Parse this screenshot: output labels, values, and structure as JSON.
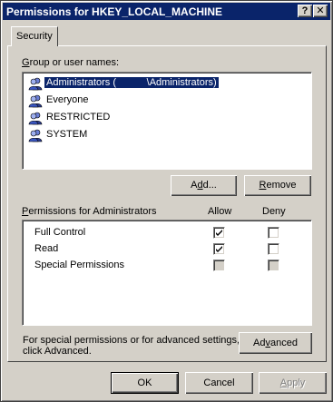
{
  "window": {
    "title": "Permissions for HKEY_LOCAL_MACHINE",
    "help_glyph": "?",
    "close_glyph": "✕"
  },
  "tabs": [
    {
      "label": "Security"
    }
  ],
  "groups": {
    "label_prefix": "G",
    "label_rest": "roup or user names:",
    "items": [
      {
        "name": "Administrators (",
        "suffix": "\\Administrators)",
        "selected": true,
        "icon": "users-group-icon"
      },
      {
        "name": "Everyone",
        "selected": false,
        "icon": "users-group-icon"
      },
      {
        "name": "RESTRICTED",
        "selected": false,
        "icon": "users-group-icon"
      },
      {
        "name": "SYSTEM",
        "selected": false,
        "icon": "users-group-icon"
      }
    ],
    "add_button": {
      "pre": "A",
      "u": "d",
      "post": "d..."
    },
    "remove_button": {
      "u": "R",
      "post": "emove"
    }
  },
  "permissions": {
    "label_u": "P",
    "label_rest": "ermissions for Administrators",
    "col_allow": "Allow",
    "col_deny": "Deny",
    "rows": [
      {
        "name": "Full Control",
        "allow": true,
        "deny": false,
        "disabled": false
      },
      {
        "name": "Read",
        "allow": true,
        "deny": false,
        "disabled": false
      },
      {
        "name": "Special Permissions",
        "allow": false,
        "deny": false,
        "disabled": true
      }
    ]
  },
  "advanced": {
    "info_line1": "For special permissions or for advanced settings,",
    "info_line2": "click Advanced.",
    "button": {
      "pre": "Ad",
      "u": "v",
      "post": "anced"
    }
  },
  "footer": {
    "ok": "OK",
    "cancel": "Cancel",
    "apply_u": "A",
    "apply_rest": "pply"
  }
}
